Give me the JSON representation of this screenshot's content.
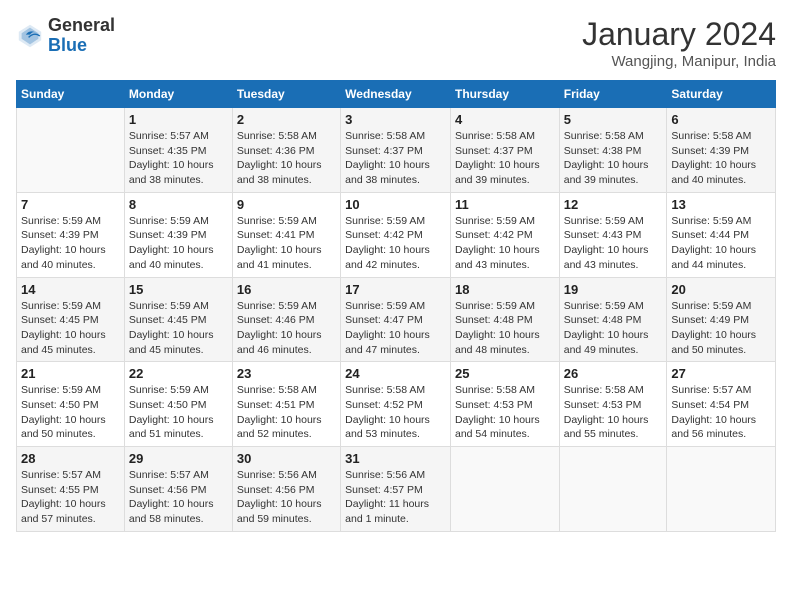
{
  "header": {
    "logo_text_general": "General",
    "logo_text_blue": "Blue",
    "month_title": "January 2024",
    "subtitle": "Wangjing, Manipur, India"
  },
  "weekdays": [
    "Sunday",
    "Monday",
    "Tuesday",
    "Wednesday",
    "Thursday",
    "Friday",
    "Saturday"
  ],
  "weeks": [
    [
      {
        "day": "",
        "sunrise": "",
        "sunset": "",
        "daylight": ""
      },
      {
        "day": "1",
        "sunrise": "Sunrise: 5:57 AM",
        "sunset": "Sunset: 4:35 PM",
        "daylight": "Daylight: 10 hours and 38 minutes."
      },
      {
        "day": "2",
        "sunrise": "Sunrise: 5:58 AM",
        "sunset": "Sunset: 4:36 PM",
        "daylight": "Daylight: 10 hours and 38 minutes."
      },
      {
        "day": "3",
        "sunrise": "Sunrise: 5:58 AM",
        "sunset": "Sunset: 4:37 PM",
        "daylight": "Daylight: 10 hours and 38 minutes."
      },
      {
        "day": "4",
        "sunrise": "Sunrise: 5:58 AM",
        "sunset": "Sunset: 4:37 PM",
        "daylight": "Daylight: 10 hours and 39 minutes."
      },
      {
        "day": "5",
        "sunrise": "Sunrise: 5:58 AM",
        "sunset": "Sunset: 4:38 PM",
        "daylight": "Daylight: 10 hours and 39 minutes."
      },
      {
        "day": "6",
        "sunrise": "Sunrise: 5:58 AM",
        "sunset": "Sunset: 4:39 PM",
        "daylight": "Daylight: 10 hours and 40 minutes."
      }
    ],
    [
      {
        "day": "7",
        "sunrise": "Sunrise: 5:59 AM",
        "sunset": "Sunset: 4:39 PM",
        "daylight": "Daylight: 10 hours and 40 minutes."
      },
      {
        "day": "8",
        "sunrise": "Sunrise: 5:59 AM",
        "sunset": "Sunset: 4:39 PM",
        "daylight": "Daylight: 10 hours and 40 minutes."
      },
      {
        "day": "9",
        "sunrise": "Sunrise: 5:59 AM",
        "sunset": "Sunset: 4:41 PM",
        "daylight": "Daylight: 10 hours and 41 minutes."
      },
      {
        "day": "10",
        "sunrise": "Sunrise: 5:59 AM",
        "sunset": "Sunset: 4:42 PM",
        "daylight": "Daylight: 10 hours and 42 minutes."
      },
      {
        "day": "11",
        "sunrise": "Sunrise: 5:59 AM",
        "sunset": "Sunset: 4:42 PM",
        "daylight": "Daylight: 10 hours and 43 minutes."
      },
      {
        "day": "12",
        "sunrise": "Sunrise: 5:59 AM",
        "sunset": "Sunset: 4:43 PM",
        "daylight": "Daylight: 10 hours and 43 minutes."
      },
      {
        "day": "13",
        "sunrise": "Sunrise: 5:59 AM",
        "sunset": "Sunset: 4:44 PM",
        "daylight": "Daylight: 10 hours and 44 minutes."
      }
    ],
    [
      {
        "day": "14",
        "sunrise": "Sunrise: 5:59 AM",
        "sunset": "Sunset: 4:45 PM",
        "daylight": "Daylight: 10 hours and 45 minutes."
      },
      {
        "day": "15",
        "sunrise": "Sunrise: 5:59 AM",
        "sunset": "Sunset: 4:45 PM",
        "daylight": "Daylight: 10 hours and 45 minutes."
      },
      {
        "day": "16",
        "sunrise": "Sunrise: 5:59 AM",
        "sunset": "Sunset: 4:46 PM",
        "daylight": "Daylight: 10 hours and 46 minutes."
      },
      {
        "day": "17",
        "sunrise": "Sunrise: 5:59 AM",
        "sunset": "Sunset: 4:47 PM",
        "daylight": "Daylight: 10 hours and 47 minutes."
      },
      {
        "day": "18",
        "sunrise": "Sunrise: 5:59 AM",
        "sunset": "Sunset: 4:48 PM",
        "daylight": "Daylight: 10 hours and 48 minutes."
      },
      {
        "day": "19",
        "sunrise": "Sunrise: 5:59 AM",
        "sunset": "Sunset: 4:48 PM",
        "daylight": "Daylight: 10 hours and 49 minutes."
      },
      {
        "day": "20",
        "sunrise": "Sunrise: 5:59 AM",
        "sunset": "Sunset: 4:49 PM",
        "daylight": "Daylight: 10 hours and 50 minutes."
      }
    ],
    [
      {
        "day": "21",
        "sunrise": "Sunrise: 5:59 AM",
        "sunset": "Sunset: 4:50 PM",
        "daylight": "Daylight: 10 hours and 50 minutes."
      },
      {
        "day": "22",
        "sunrise": "Sunrise: 5:59 AM",
        "sunset": "Sunset: 4:50 PM",
        "daylight": "Daylight: 10 hours and 51 minutes."
      },
      {
        "day": "23",
        "sunrise": "Sunrise: 5:58 AM",
        "sunset": "Sunset: 4:51 PM",
        "daylight": "Daylight: 10 hours and 52 minutes."
      },
      {
        "day": "24",
        "sunrise": "Sunrise: 5:58 AM",
        "sunset": "Sunset: 4:52 PM",
        "daylight": "Daylight: 10 hours and 53 minutes."
      },
      {
        "day": "25",
        "sunrise": "Sunrise: 5:58 AM",
        "sunset": "Sunset: 4:53 PM",
        "daylight": "Daylight: 10 hours and 54 minutes."
      },
      {
        "day": "26",
        "sunrise": "Sunrise: 5:58 AM",
        "sunset": "Sunset: 4:53 PM",
        "daylight": "Daylight: 10 hours and 55 minutes."
      },
      {
        "day": "27",
        "sunrise": "Sunrise: 5:57 AM",
        "sunset": "Sunset: 4:54 PM",
        "daylight": "Daylight: 10 hours and 56 minutes."
      }
    ],
    [
      {
        "day": "28",
        "sunrise": "Sunrise: 5:57 AM",
        "sunset": "Sunset: 4:55 PM",
        "daylight": "Daylight: 10 hours and 57 minutes."
      },
      {
        "day": "29",
        "sunrise": "Sunrise: 5:57 AM",
        "sunset": "Sunset: 4:56 PM",
        "daylight": "Daylight: 10 hours and 58 minutes."
      },
      {
        "day": "30",
        "sunrise": "Sunrise: 5:56 AM",
        "sunset": "Sunset: 4:56 PM",
        "daylight": "Daylight: 10 hours and 59 minutes."
      },
      {
        "day": "31",
        "sunrise": "Sunrise: 5:56 AM",
        "sunset": "Sunset: 4:57 PM",
        "daylight": "Daylight: 11 hours and 1 minute."
      },
      {
        "day": "",
        "sunrise": "",
        "sunset": "",
        "daylight": ""
      },
      {
        "day": "",
        "sunrise": "",
        "sunset": "",
        "daylight": ""
      },
      {
        "day": "",
        "sunrise": "",
        "sunset": "",
        "daylight": ""
      }
    ]
  ]
}
